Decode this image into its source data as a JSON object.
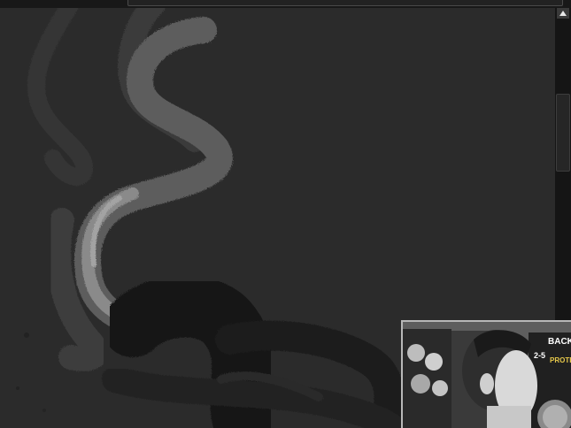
{
  "window": {
    "has_top_field": true
  },
  "scrollbar": {
    "up_icon": "scroll-up-arrow-icon",
    "position_fraction": 0.2
  },
  "webcam_overlay": {
    "poster_text_1": "BACK",
    "poster_text_2": "2-5",
    "poster_text_3": "PROTECT"
  }
}
